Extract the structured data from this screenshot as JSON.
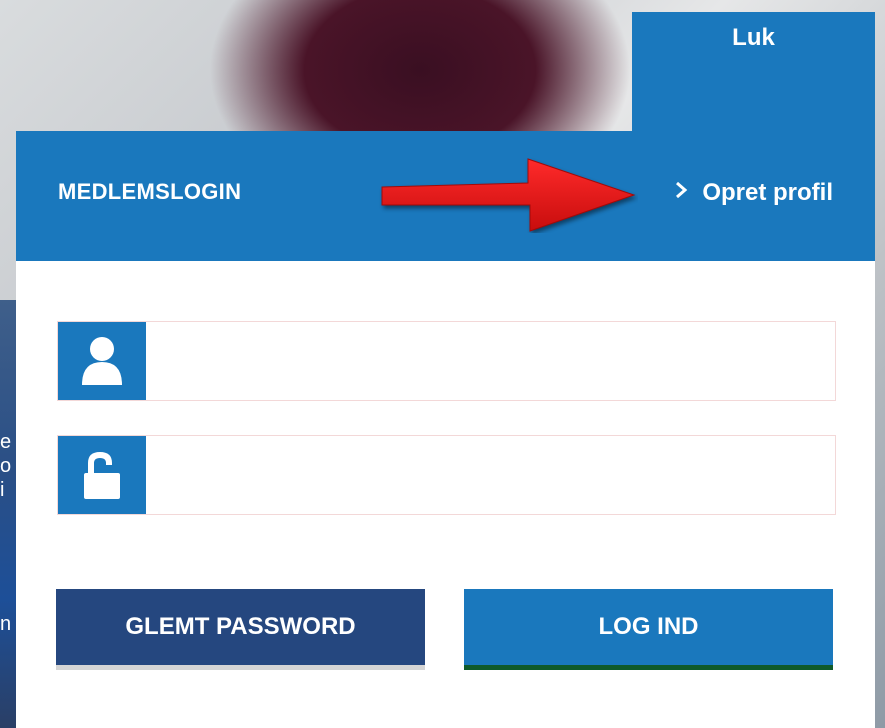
{
  "close_tab": {
    "label": "Luk"
  },
  "panel": {
    "title": "MEDLEMSLOGIN",
    "create_profile_link": "Opret profil"
  },
  "fields": {
    "username": {
      "value": "",
      "placeholder": ""
    },
    "password": {
      "value": "",
      "placeholder": ""
    }
  },
  "buttons": {
    "forgot_password": "GLEMT PASSWORD",
    "login": "LOG IND"
  },
  "background_text": [
    "e",
    "o",
    "i",
    "n"
  ],
  "icons": {
    "user": "user-icon",
    "lock": "unlocked-padlock-icon",
    "chevron": "chevron-right-icon",
    "annotation": "red-arrow-icon"
  },
  "colors": {
    "primary_blue": "#1a78bd",
    "dark_blue": "#25477f",
    "login_shadow": "#0f5a2a",
    "annotation_red": "#e31212"
  }
}
